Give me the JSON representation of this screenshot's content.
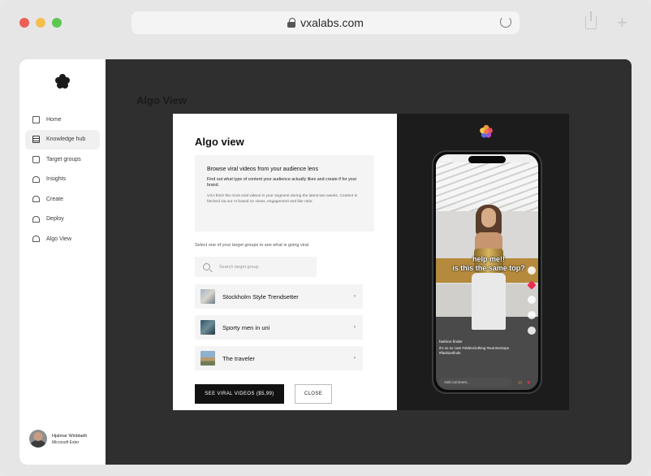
{
  "browser": {
    "url": "vxalabs.com"
  },
  "sidebar": {
    "items": [
      {
        "label": "Home",
        "icon": "home-icon",
        "active": false
      },
      {
        "label": "Knowledge hub",
        "icon": "document-icon",
        "active": true
      },
      {
        "label": "Target groups",
        "icon": "folder-icon",
        "active": false
      },
      {
        "label": "Insights",
        "icon": "bell-icon",
        "active": false
      },
      {
        "label": "Create",
        "icon": "bell-icon",
        "active": false
      },
      {
        "label": "Deploy",
        "icon": "bell-icon",
        "active": false
      },
      {
        "label": "Algo View",
        "icon": "bell-icon",
        "active": false
      }
    ],
    "user": {
      "name": "Hjalmar Winbladh",
      "company": "Microsoft Exter"
    }
  },
  "page": {
    "title": "Algo View"
  },
  "modal": {
    "title": "Algo view",
    "info": {
      "heading": "Browse viral videos from your audience lens",
      "body": "Find out what type of content your audience actually likes and create if for your brand.",
      "note": "VXA fetch the most viral videos in your segment during the latest two weeks. Content is fetched via our AI based on views, engagement and like ratio."
    },
    "select_label": "Select one of your target groups to see what is going viral",
    "search_placeholder": "Search target group",
    "groups": [
      {
        "name": "Stockholm Style Trendsetter",
        "chevron": "›"
      },
      {
        "name": "Sporty men in uni",
        "chevron": "›"
      },
      {
        "name": "The traveler",
        "chevron": "›"
      }
    ],
    "primary_button": "SEE VIRAL VIDEOS ($5,99)",
    "secondary_button": "CLOSE"
  },
  "preview": {
    "status_time": "10:30",
    "caption_line1": "help me!!",
    "caption_line2": "is this the same top?",
    "username": "fashion finder",
    "description": "it's so so cute #oldenclothing #summertops #fashionfinds",
    "comment_placeholder": "Add comment..."
  },
  "colors": {
    "accent_dark": "#121212",
    "app_background": "#2f2f2f",
    "heart": "#ee2b50"
  }
}
